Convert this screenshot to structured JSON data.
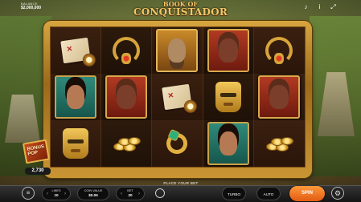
{
  "balance": {
    "label": "BALANCE",
    "value": "$2,000,000"
  },
  "title": {
    "line1": "BOOK OF",
    "line2": "CONQUISTADOR"
  },
  "top_icons": [
    "sound-icon",
    "info-icon",
    "fullscreen-icon"
  ],
  "reels": [
    [
      "map-compass",
      "woman-green",
      "warrior-gold-mask"
    ],
    [
      "necklace",
      "warrior-red",
      "coins"
    ],
    [
      "conquistador-red",
      "map-compass",
      "emerald-ring"
    ],
    [
      "warrior-red",
      "gold-mask",
      "woman-green"
    ],
    [
      "necklace",
      "warrior-red",
      "coins"
    ]
  ],
  "bonus": {
    "label_1": "BONUS",
    "label_2": "POP",
    "count": "2,730"
  },
  "status_text": "PLACE YOUR BET",
  "controls": {
    "lines": {
      "label": "LINES",
      "value": "10"
    },
    "coin_value": {
      "label": "COIN VALUE",
      "value": "$0.05"
    },
    "bet": {
      "label": "BET",
      "value": "20"
    },
    "turbo": "TURBO",
    "auto": "AUTO",
    "spin": "SPIN"
  },
  "colors": {
    "spin": "#f07a22",
    "frame_gold": "#d7a640",
    "bar": "#1e1e1e"
  }
}
